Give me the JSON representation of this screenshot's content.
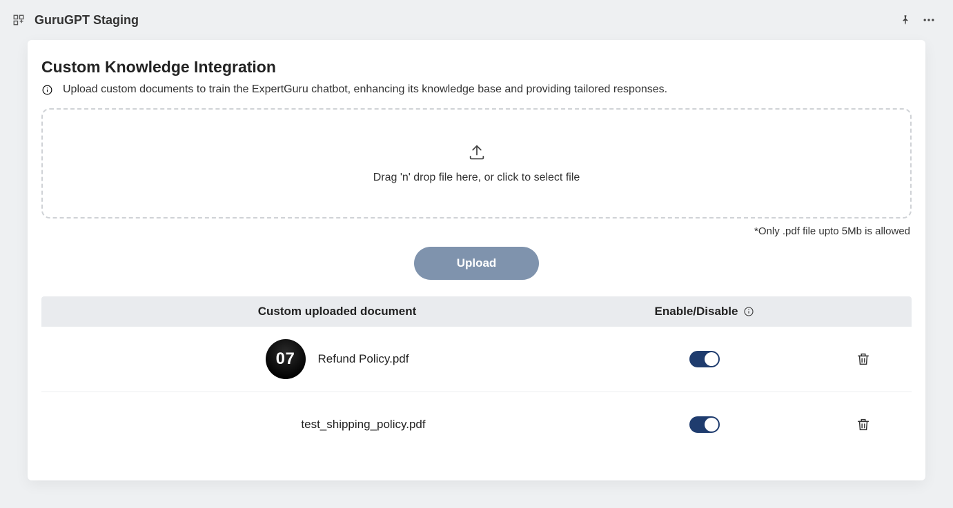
{
  "header": {
    "title": "GuruGPT Staging"
  },
  "section": {
    "title": "Custom Knowledge Integration",
    "description": "Upload custom documents to train the ExpertGuru chatbot, enhancing its knowledge base and providing tailored responses."
  },
  "dropzone": {
    "text": "Drag 'n' drop file here, or click to select file"
  },
  "file_note": "*Only .pdf file upto 5Mb is allowed",
  "upload_button": "Upload",
  "table": {
    "col_document": "Custom uploaded document",
    "col_enable": "Enable/Disable"
  },
  "documents": [
    {
      "badge": "07",
      "name": "Refund Policy.pdf",
      "enabled": true
    },
    {
      "badge": "",
      "name": "test_shipping_policy.pdf",
      "enabled": true
    }
  ]
}
